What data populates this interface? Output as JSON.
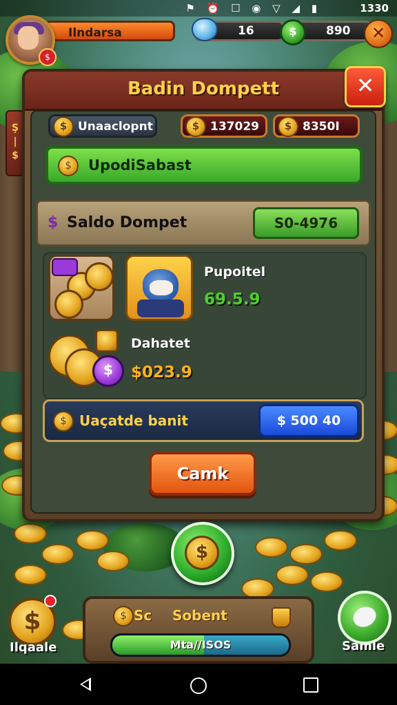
{
  "status_bar": {
    "icons": "⚑ ⏰ ☐ ◉ ▽ ◢ ▮",
    "time": "1330"
  },
  "hud": {
    "player_name": "Ilndarsa",
    "gems": "16",
    "cash": "890",
    "cash_icon_glyph": "$"
  },
  "panel": {
    "title": "Badin Dompett",
    "side_tab_glyphs": "Ş\n|\n$",
    "currency_label": "Unaaclopnt",
    "stat1": "137029",
    "stat2": "8350I",
    "green_bar_label": "UpodiSabast",
    "saldo_label": "Saldo Dompet",
    "saldo_value": "S0-4976",
    "items": [
      {
        "name": "Pupoitel",
        "value": "69.5.9",
        "color": "#4ad02a"
      },
      {
        "name": "Dahatet",
        "value": "$023.9",
        "color": "#ffb21a"
      }
    ],
    "bank_label": "Uaçatde banit",
    "bank_value": "$ 500 40",
    "cta_label": "Camk"
  },
  "bottom": {
    "left_label": "Ilqaale",
    "right_label": "Samle",
    "panel_prefix": "Sc",
    "panel_title": "Sobent",
    "progress_text": "Mta//ISOS",
    "progress_fraction": 0.52
  },
  "colors": {
    "accent": "#ffd24a",
    "panel": "#6a4a30",
    "green": "#3aa82a",
    "blue": "#1a4ad8",
    "orange": "#e2540e"
  }
}
